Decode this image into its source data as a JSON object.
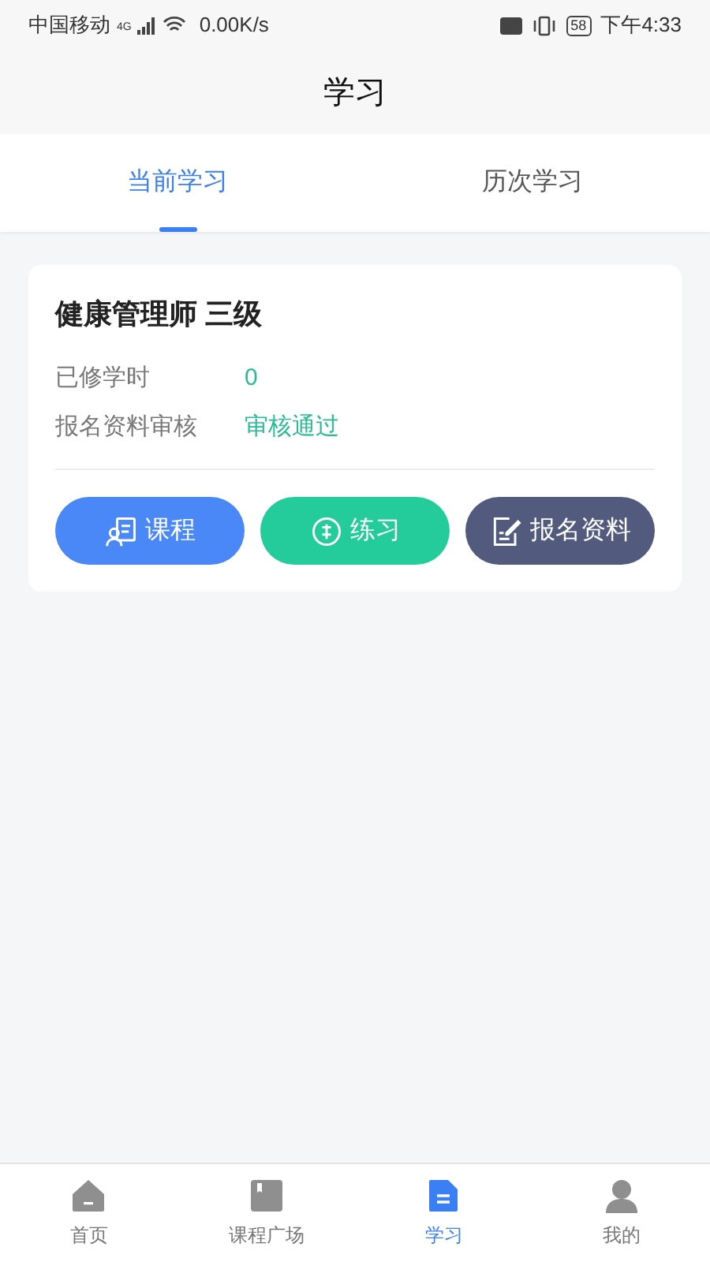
{
  "status_bar": {
    "carrier": "中国移动",
    "network": "4G",
    "speed": "0.00K/s",
    "battery": "58",
    "time": "下午4:33"
  },
  "header": {
    "title": "学习"
  },
  "tabs": [
    {
      "label": "当前学习",
      "selected": true
    },
    {
      "label": "历次学习",
      "selected": false
    }
  ],
  "course_card": {
    "title": "健康管理师 三级",
    "fields": [
      {
        "label": "已修学时",
        "value": "0"
      },
      {
        "label": "报名资料审核",
        "value": "审核通过"
      }
    ],
    "buttons": [
      {
        "label": "课程",
        "kind": "course",
        "color": "#4a88f7"
      },
      {
        "label": "练习",
        "kind": "practice",
        "color": "#24cc9c"
      },
      {
        "label": "报名资料",
        "kind": "materials",
        "color": "#525b7e"
      }
    ]
  },
  "bottom_nav": [
    {
      "label": "首页",
      "kind": "home",
      "selected": false
    },
    {
      "label": "课程广场",
      "kind": "book",
      "selected": false
    },
    {
      "label": "学习",
      "kind": "doc",
      "selected": true
    },
    {
      "label": "我的",
      "kind": "user",
      "selected": false
    }
  ]
}
